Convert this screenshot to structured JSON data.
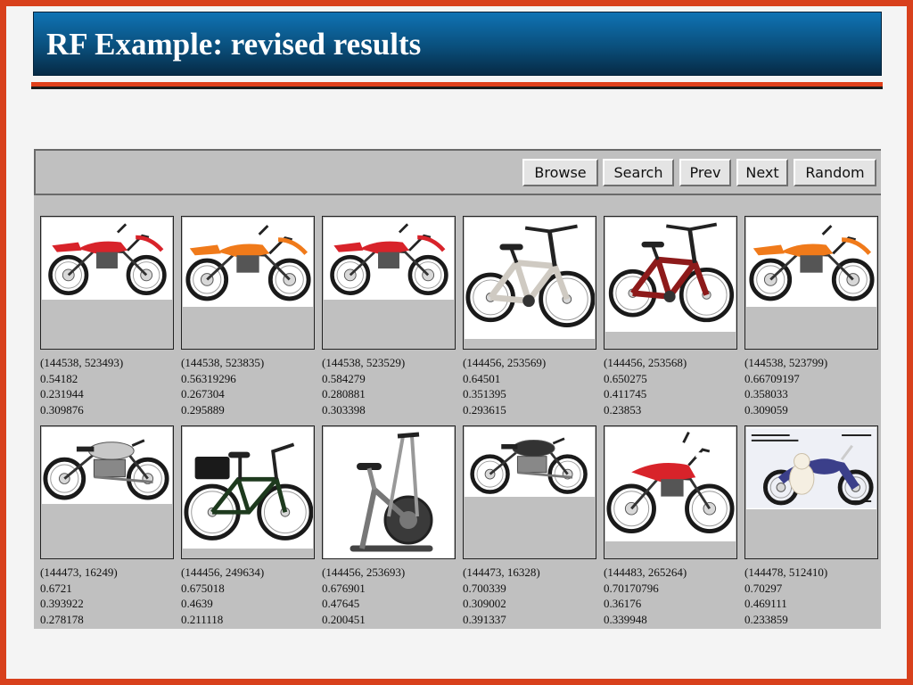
{
  "slide": {
    "title": "RF Example: revised results"
  },
  "toolbar": {
    "browse_label": "Browse",
    "search_label": "Search",
    "prev_label": "Prev",
    "next_label": "Next",
    "random_label": "Random"
  },
  "results": [
    {
      "id": "(144538, 523493)",
      "v1": "0.54182",
      "v2": "0.231944",
      "v3": "0.309876",
      "kind": "motocross-red"
    },
    {
      "id": "(144538, 523835)",
      "v1": "0.56319296",
      "v2": "0.267304",
      "v3": "0.295889",
      "kind": "motocross-orange"
    },
    {
      "id": "(144538, 523529)",
      "v1": "0.584279",
      "v2": "0.280881",
      "v3": "0.303398",
      "kind": "motocross-red"
    },
    {
      "id": "(144456, 253569)",
      "v1": "0.64501",
      "v2": "0.351395",
      "v3": "0.293615",
      "kind": "bmx-silver"
    },
    {
      "id": "(144456, 253568)",
      "v1": "0.650275",
      "v2": "0.411745",
      "v3": "0.23853",
      "kind": "bmx-red"
    },
    {
      "id": "(144538, 523799)",
      "v1": "0.66709197",
      "v2": "0.358033",
      "v3": "0.309059",
      "kind": "motocross-orange"
    },
    {
      "id": "(144473, 16249)",
      "v1": "0.6721",
      "v2": "0.393922",
      "v3": "0.278178",
      "kind": "vintage-motorcycle"
    },
    {
      "id": "(144456, 249634)",
      "v1": "0.675018",
      "v2": "0.4639",
      "v3": "0.211118",
      "kind": "city-bicycle"
    },
    {
      "id": "(144456, 253693)",
      "v1": "0.676901",
      "v2": "0.47645",
      "v3": "0.200451",
      "kind": "exercise-bike"
    },
    {
      "id": "(144473, 16328)",
      "v1": "0.700339",
      "v2": "0.309002",
      "v3": "0.391337",
      "kind": "vintage-motorcycle-2"
    },
    {
      "id": "(144483, 265264)",
      "v1": "0.70170796",
      "v2": "0.36176",
      "v3": "0.339948",
      "kind": "dirtbike-red"
    },
    {
      "id": "(144478, 512410)",
      "v1": "0.70297",
      "v2": "0.469111",
      "v3": "0.233859",
      "kind": "cruiser-dog"
    }
  ],
  "colors": {
    "slide_border": "#d8401c",
    "title_bar": "#0a4f7c",
    "app_panel": "#c0c0c0"
  }
}
